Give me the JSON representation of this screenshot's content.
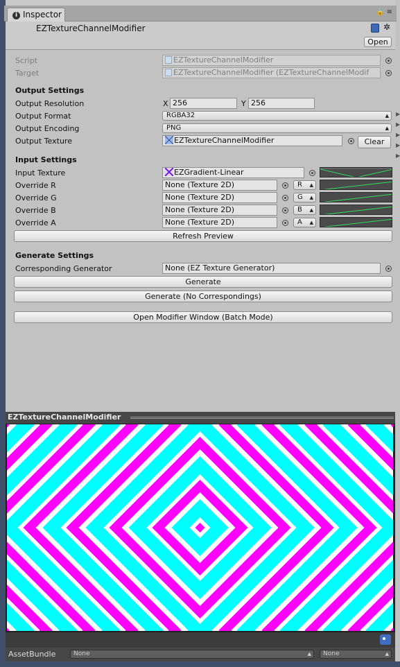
{
  "inspector_tab": {
    "label": "Inspector"
  },
  "header": {
    "title": "EZTextureChannelModifier",
    "open_label": "Open"
  },
  "script_row": {
    "label": "Script",
    "value": "EZTextureChannelModifier"
  },
  "target_row": {
    "label": "Target",
    "value": "EZTextureChannelModifier (EZTextureChannelModif"
  },
  "output_settings": {
    "title": "Output Settings",
    "resolution": {
      "label": "Output Resolution",
      "x_label": "X",
      "x_value": "256",
      "y_label": "Y",
      "y_value": "256"
    },
    "format": {
      "label": "Output Format",
      "value": "RGBA32"
    },
    "encoding": {
      "label": "Output Encoding",
      "value": "PNG"
    },
    "texture": {
      "label": "Output Texture",
      "value": "EZTextureChannelModifier",
      "clear_label": "Clear"
    }
  },
  "input_settings": {
    "title": "Input Settings",
    "input_texture": {
      "label": "Input Texture",
      "value": "EZGradient-Linear"
    },
    "overrides": [
      {
        "label": "Override R",
        "value": "None (Texture 2D)",
        "channel": "R"
      },
      {
        "label": "Override G",
        "value": "None (Texture 2D)",
        "channel": "G"
      },
      {
        "label": "Override B",
        "value": "None (Texture 2D)",
        "channel": "B"
      },
      {
        "label": "Override A",
        "value": "None (Texture 2D)",
        "channel": "A"
      }
    ],
    "refresh_label": "Refresh Preview"
  },
  "generate_settings": {
    "title": "Generate Settings",
    "generator": {
      "label": "Corresponding Generator",
      "value": "None (EZ Texture Generator)"
    },
    "generate_label": "Generate",
    "generate_no_corr_label": "Generate (No Correspondings)",
    "open_window_label": "Open Modifier Window (Batch Mode)"
  },
  "preview": {
    "title": "EZTextureChannelModifier",
    "colors": {
      "cyan": "#00ffff",
      "magenta": "#ff00ff",
      "white": "#ffffff"
    }
  },
  "asset_bundle": {
    "label": "AssetBundle",
    "name_value": "None",
    "variant_value": "None"
  }
}
